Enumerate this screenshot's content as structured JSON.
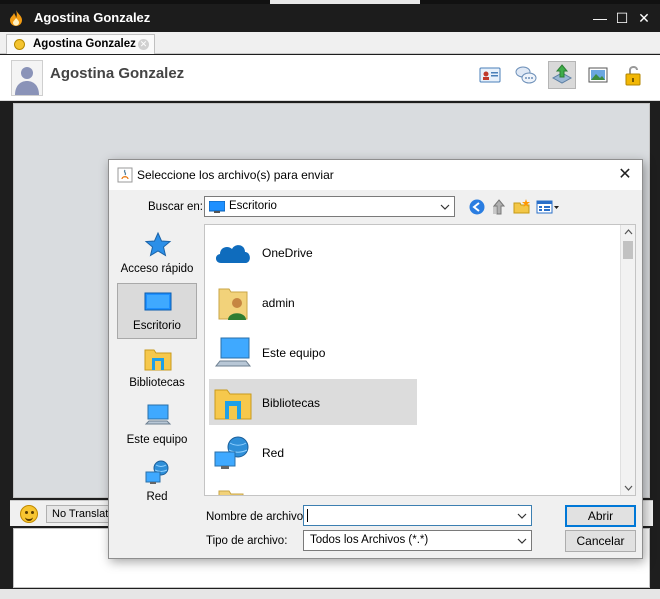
{
  "window": {
    "title": "Agostina Gonzalez",
    "controls": {
      "minimize": "—",
      "maximize": "☐",
      "close": "✕"
    }
  },
  "tabs": [
    {
      "label": "Agostina Gonzalez",
      "icon": "smiley-icon",
      "close": "✕"
    }
  ],
  "chat": {
    "contact_name": "Agostina Gonzalez",
    "toolbar": [
      {
        "name": "contact-card-icon",
        "active": false
      },
      {
        "name": "chat-bubbles-icon",
        "active": false
      },
      {
        "name": "send-file-icon",
        "active": true
      },
      {
        "name": "picture-icon",
        "active": false
      },
      {
        "name": "unlock-icon",
        "active": false
      }
    ],
    "translate_label": "No Translation"
  },
  "dialog": {
    "title": "Seleccione los archivo(s) para enviar",
    "close": "✕",
    "look_in_label": "Buscar en:",
    "look_in_value": "Escritorio",
    "nav_icons": [
      "back-icon",
      "up-folder-icon",
      "new-folder-icon",
      "view-menu-icon"
    ],
    "sidebar": [
      {
        "label": "Acceso rápido",
        "icon": "star-icon",
        "selected": false
      },
      {
        "label": "Escritorio",
        "icon": "desktop-icon",
        "selected": true
      },
      {
        "label": "Bibliotecas",
        "icon": "libraries-icon",
        "selected": false
      },
      {
        "label": "Este equipo",
        "icon": "computer-icon",
        "selected": false
      },
      {
        "label": "Red",
        "icon": "network-icon",
        "selected": false
      }
    ],
    "files": [
      {
        "name": "OneDrive",
        "icon": "cloud-icon",
        "selected": false
      },
      {
        "name": "admin",
        "icon": "user-folder-icon",
        "selected": false
      },
      {
        "name": "Este equipo",
        "icon": "computer-icon",
        "selected": false
      },
      {
        "name": "Bibliotecas",
        "icon": "libraries-icon",
        "selected": true
      },
      {
        "name": "Red",
        "icon": "network-icon",
        "selected": false
      }
    ],
    "filename_label": "Nombre de archivo:",
    "filename_value": "",
    "filetype_label": "Tipo de archivo:",
    "filetype_value": "Todos los Archivos (*.*)",
    "open_button": "Abrir",
    "cancel_button": "Cancelar"
  },
  "colors": {
    "titlebar": "#1c1c1c",
    "selection": "#dcdcdc",
    "focus_border": "#0078d7"
  }
}
